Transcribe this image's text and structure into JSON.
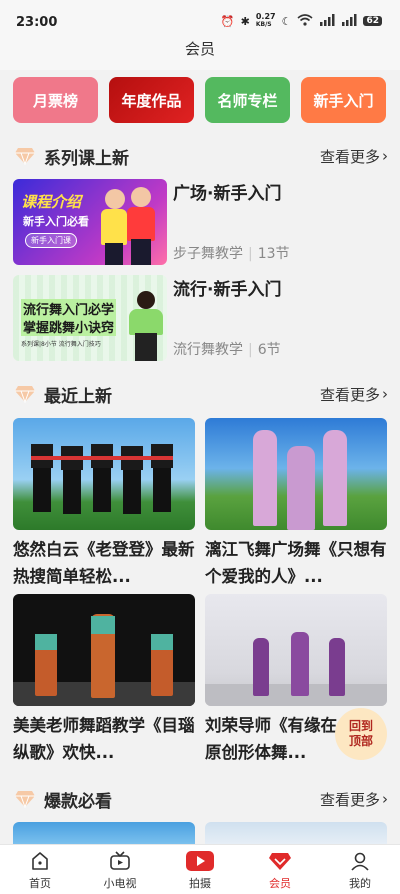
{
  "status": {
    "time": "23:00",
    "speed_top": "0.27",
    "speed_unit": "KB/S",
    "battery": "62"
  },
  "header": {
    "title": "会员"
  },
  "categories": [
    {
      "label": "月票榜"
    },
    {
      "label": "年度作品"
    },
    {
      "label": "名师专栏"
    },
    {
      "label": "新手入门"
    }
  ],
  "series": {
    "title": "系列课上新",
    "see_more": "查看更多",
    "items": [
      {
        "title": "广场·新手入门",
        "author": "步子舞教学",
        "count": "13节",
        "thumb_line1": "课程介绍",
        "thumb_line2": "新手入门必看",
        "thumb_tag": "新手入门课"
      },
      {
        "title": "流行·新手入门",
        "author": "流行舞教学",
        "count": "6节",
        "thumb_line1": "流行舞入门必学",
        "thumb_line2": "掌握跳舞小诀窍",
        "thumb_tag": "系列课|8小节 流行舞入门技巧"
      }
    ]
  },
  "latest": {
    "title": "最近上新",
    "see_more": "查看更多",
    "items": [
      {
        "caption": "悠然白云《老登登》最新热搜简单轻松..."
      },
      {
        "caption": "漓江飞舞广场舞《只想有个爱我的人》..."
      },
      {
        "caption": "美美老师舞蹈教学《目瑙纵歌》欢快..."
      },
      {
        "caption": "刘荣导师《有缘在一起》原创形体舞..."
      }
    ]
  },
  "popular": {
    "title": "爆款必看",
    "see_more": "查看更多"
  },
  "back_to_top": {
    "line1": "回到",
    "line2": "顶部"
  },
  "nav": [
    {
      "label": "首页",
      "icon": "home-icon"
    },
    {
      "label": "小电视",
      "icon": "tv-icon"
    },
    {
      "label": "拍摄",
      "icon": "camera-icon"
    },
    {
      "label": "会员",
      "icon": "vip-icon"
    },
    {
      "label": "我的",
      "icon": "profile-icon"
    }
  ],
  "colors": {
    "accent": "#e02b2b",
    "bg": "#f2f2f2"
  }
}
